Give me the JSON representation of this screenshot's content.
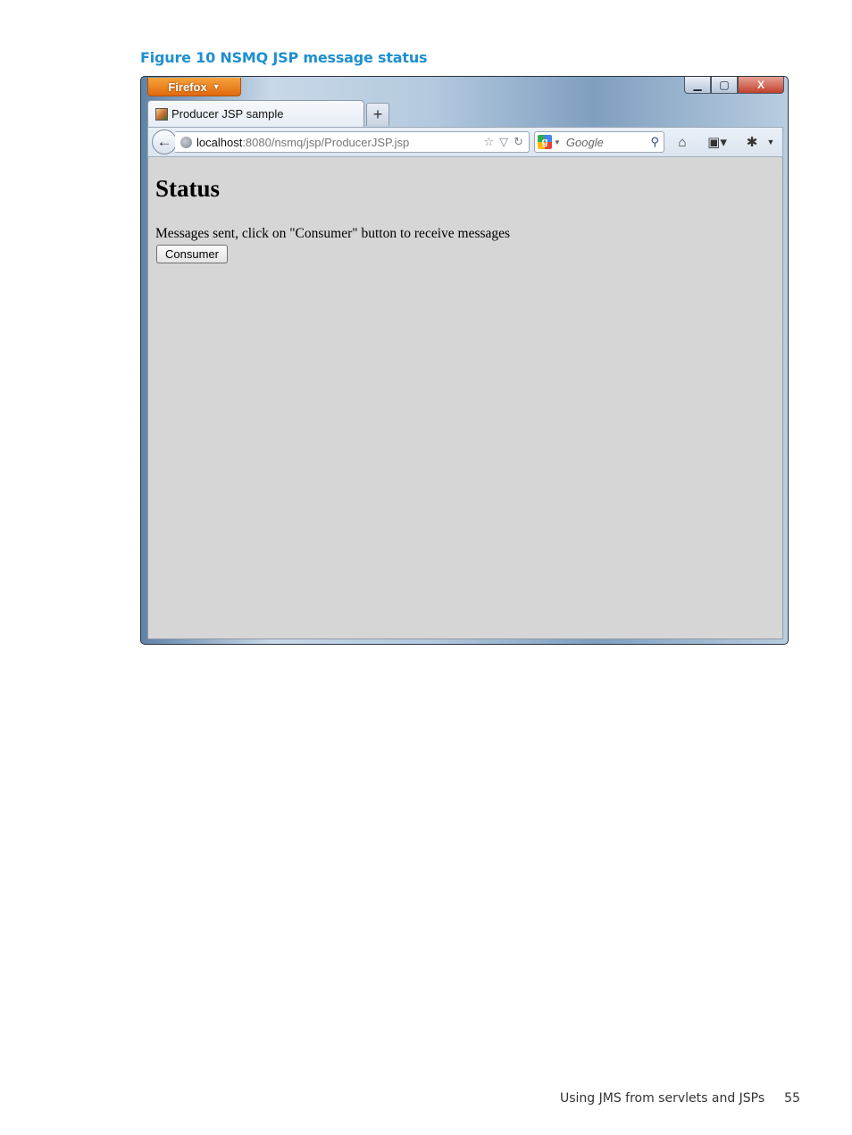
{
  "figure": {
    "caption": "Figure 10 NSMQ JSP message status"
  },
  "browser": {
    "app_button": "Firefox",
    "window_controls": {
      "minimize": "▁",
      "maximize": "▢",
      "close": "X"
    },
    "tab": {
      "title": "Producer JSP sample"
    },
    "new_tab_label": "+",
    "address": {
      "host": "localhost",
      "rest": ":8080/nsmq/jsp/ProducerJSP.jsp"
    },
    "search": {
      "engine_icon": "g",
      "placeholder": "Google"
    }
  },
  "page": {
    "heading": "Status",
    "message": "Messages sent, click on \"Consumer\" button to receive messages",
    "consumer_button": "Consumer"
  },
  "footer": {
    "section": "Using JMS from servlets and JSPs",
    "page_number": "55"
  }
}
